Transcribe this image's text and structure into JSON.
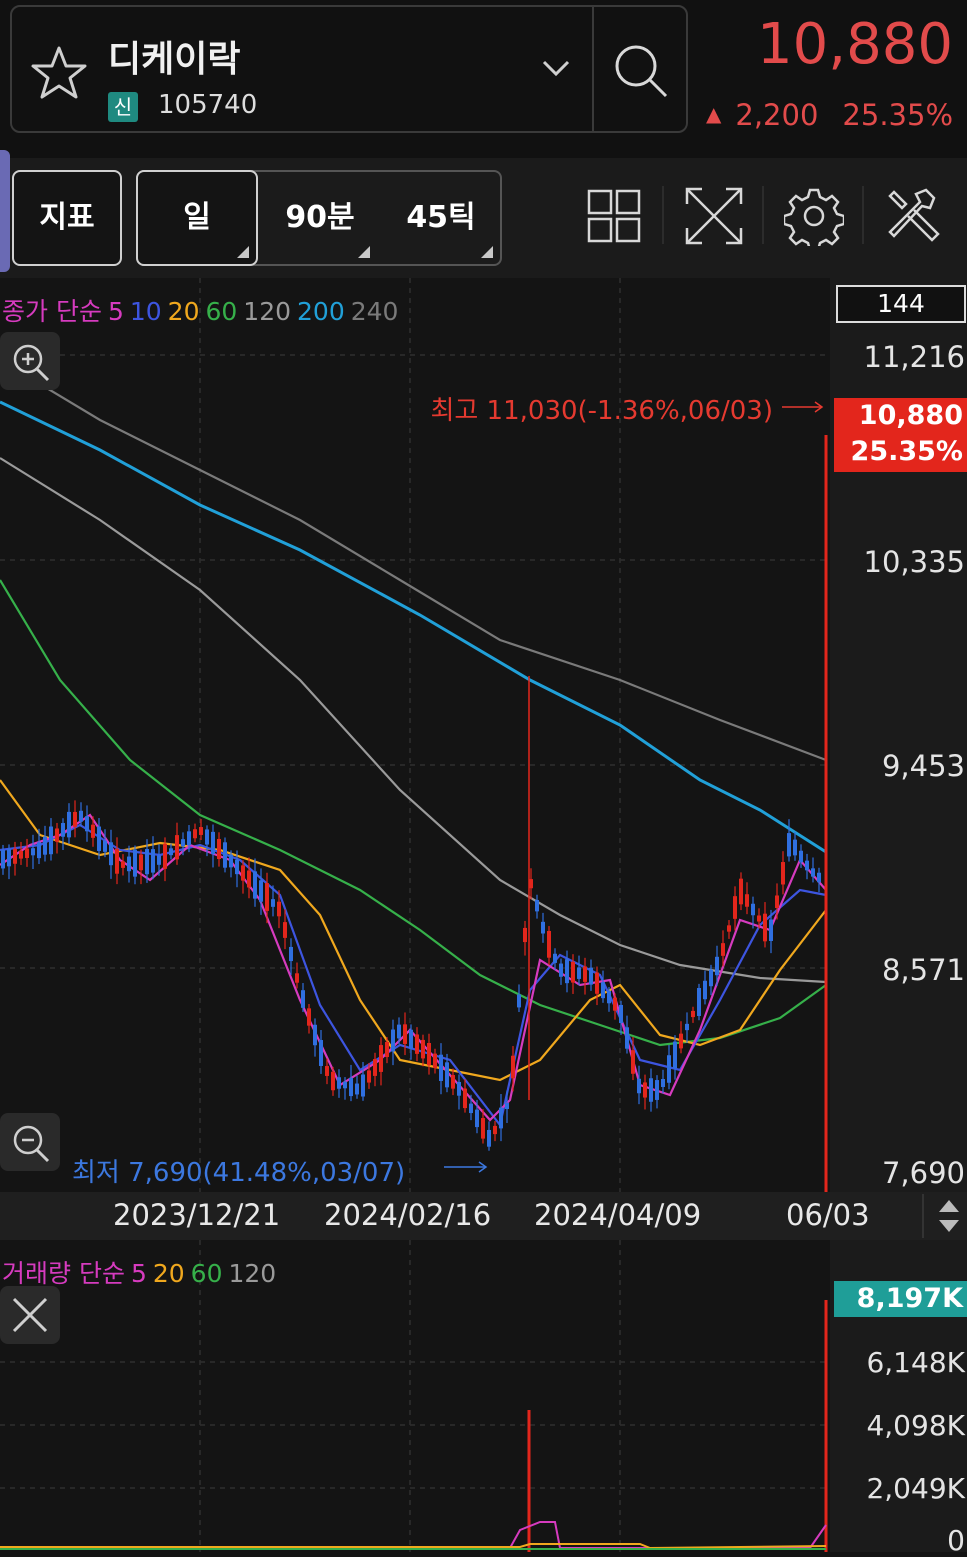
{
  "header": {
    "stock_name": "디케이락",
    "badge": "신",
    "code": "105740",
    "price": "10,880",
    "change": "2,200",
    "change_pct": "25.35%",
    "color_up": "#e24b4b"
  },
  "toolbar": {
    "indicator_label": "지표",
    "period_day": "일",
    "period_90": "90분",
    "period_45": "45틱",
    "icons": [
      "layout-grid-icon",
      "fullscreen-icon",
      "settings-gear-icon",
      "tools-icon"
    ]
  },
  "price_chart": {
    "legend_prefix": "종가 단순",
    "ma_periods": [
      {
        "label": "5",
        "color": "#d63bbf"
      },
      {
        "label": "10",
        "color": "#3d55e0"
      },
      {
        "label": "20",
        "color": "#f0a81e"
      },
      {
        "label": "60",
        "color": "#36b04a"
      },
      {
        "label": "120",
        "color": "#9a9a9a"
      },
      {
        "label": "200",
        "color": "#21a0d8"
      },
      {
        "label": "240",
        "color": "#7a7a7a"
      }
    ],
    "count": "144",
    "y_labels": [
      "11,216",
      "10,335",
      "9,453",
      "8,571",
      "7,690"
    ],
    "y_values": [
      11216,
      10335,
      9453,
      8571,
      7690
    ],
    "current_price": "10,880",
    "current_pct": "25.35%",
    "high_label": "최고 11,030(-1.36%,06/03)",
    "low_label": "최저 7,690(41.48%,03/07)",
    "dates": [
      "2023/12/21",
      "2024/02/16",
      "2024/04/09",
      "06/03"
    ]
  },
  "volume_chart": {
    "legend_prefix": "거래량 단순",
    "ma_periods": [
      {
        "label": "5",
        "color": "#d63bbf"
      },
      {
        "label": "20",
        "color": "#f0a81e"
      },
      {
        "label": "60",
        "color": "#36b04a"
      },
      {
        "label": "120",
        "color": "#9a9a9a"
      }
    ],
    "current": "8,197K",
    "y_labels": [
      "6,148K",
      "4,098K",
      "2,049K",
      "0"
    ]
  }
}
